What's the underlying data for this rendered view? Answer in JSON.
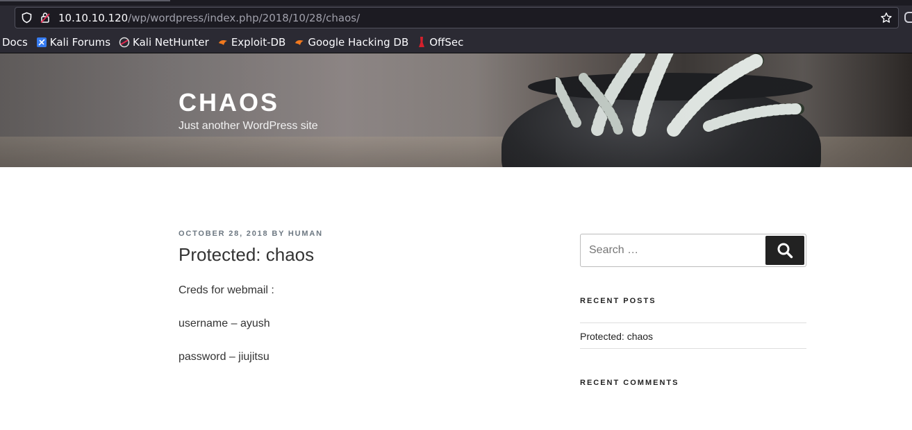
{
  "browser": {
    "url_host": "10.10.10.120",
    "url_path": "/wp/wordpress/index.php/2018/10/28/chaos/",
    "bookmarks": [
      {
        "label": "Docs",
        "icon": "none"
      },
      {
        "label": "Kali Forums",
        "icon": "kali-forums-icon"
      },
      {
        "label": "Kali NetHunter",
        "icon": "kali-nethunter-icon"
      },
      {
        "label": "Exploit-DB",
        "icon": "exploit-db-icon"
      },
      {
        "label": "Google Hacking DB",
        "icon": "exploit-db-icon"
      },
      {
        "label": "OffSec",
        "icon": "offsec-icon"
      }
    ]
  },
  "site": {
    "title": "CHAOS",
    "tagline": "Just another WordPress site"
  },
  "post": {
    "date": "OCTOBER 28, 2018",
    "by": "BY",
    "author": "HUMAN",
    "title": "Protected: chaos",
    "lines": [
      "Creds for webmail :",
      "username – ayush",
      "password – jiujitsu"
    ]
  },
  "sidebar": {
    "search_placeholder": "Search …",
    "recent_posts_title": "RECENT POSTS",
    "recent_posts": [
      "Protected: chaos"
    ],
    "recent_comments_title": "RECENT COMMENTS"
  },
  "colors": {
    "chrome_bg": "#2b2a33",
    "urlbar_bg": "#1c1b22",
    "search_button": "#222222",
    "meta_text": "#6c7781"
  }
}
